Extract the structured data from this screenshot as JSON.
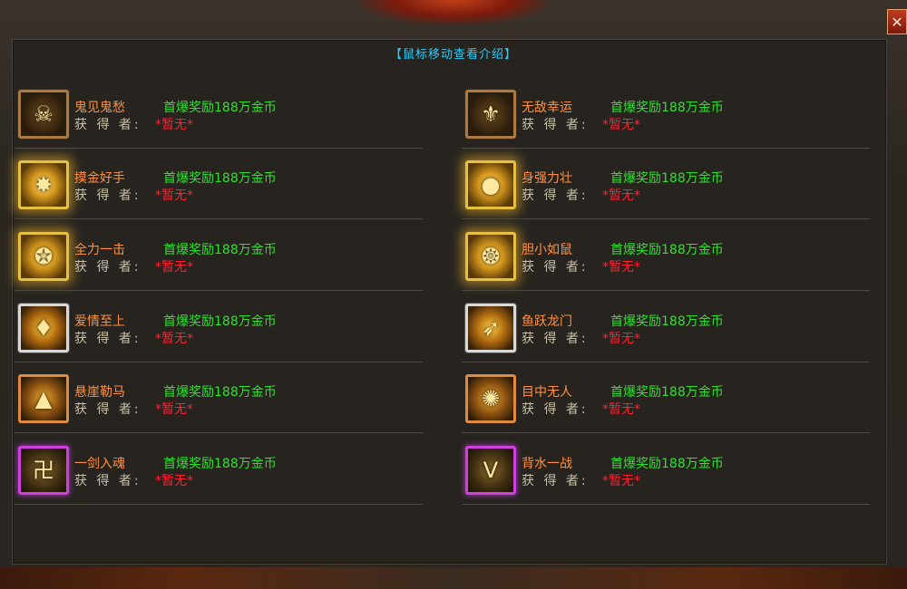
{
  "header": {
    "hint": "【鼠标移动查看介绍】",
    "close_label": "✕"
  },
  "owner_label": "获 得 者:",
  "items": [
    {
      "name": "鬼见鬼愁",
      "reward": "首爆奖励188万金币",
      "owner": "*暂无*",
      "icon": "skull-icon",
      "frame": "bronze",
      "glyph": "☠"
    },
    {
      "name": "无敌幸运",
      "reward": "首爆奖励188万金币",
      "owner": "*暂无*",
      "icon": "emblem-icon",
      "frame": "bronze",
      "glyph": "⚜"
    },
    {
      "name": "摸金好手",
      "reward": "首爆奖励188万金币",
      "owner": "*暂无*",
      "icon": "burst-icon",
      "frame": "gold",
      "glyph": "✸"
    },
    {
      "name": "身强力壮",
      "reward": "首爆奖励188万金币",
      "owner": "*暂无*",
      "icon": "orb-icon",
      "frame": "gold",
      "glyph": "●"
    },
    {
      "name": "全力一击",
      "reward": "首爆奖励188万金币",
      "owner": "*暂无*",
      "icon": "beast-icon",
      "frame": "gold",
      "glyph": "✪"
    },
    {
      "name": "胆小如鼠",
      "reward": "首爆奖励188万金币",
      "owner": "*暂无*",
      "icon": "treasure-icon",
      "frame": "gold",
      "glyph": "❂"
    },
    {
      "name": "爱情至上",
      "reward": "首爆奖励188万金币",
      "owner": "*暂无*",
      "icon": "heart-gem-icon",
      "frame": "silver",
      "glyph": "♦"
    },
    {
      "name": "鱼跃龙门",
      "reward": "首爆奖励188万金币",
      "owner": "*暂无*",
      "icon": "dragon-icon",
      "frame": "silver",
      "glyph": "➶"
    },
    {
      "name": "悬崖勒马",
      "reward": "首爆奖励188万金币",
      "owner": "*暂无*",
      "icon": "triangle-rune-icon",
      "frame": "orange",
      "glyph": "▲"
    },
    {
      "name": "目中无人",
      "reward": "首爆奖励188万金币",
      "owner": "*暂无*",
      "icon": "spiral-rune-icon",
      "frame": "orange",
      "glyph": "✺"
    },
    {
      "name": "一剑入魂",
      "reward": "首爆奖励188万金币",
      "owner": "*暂无*",
      "icon": "swastika-rune-icon",
      "frame": "purple",
      "glyph": "卍"
    },
    {
      "name": "背水一战",
      "reward": "首爆奖励188万金币",
      "owner": "*暂无*",
      "icon": "v-shield-icon",
      "frame": "purple",
      "glyph": "V"
    }
  ]
}
